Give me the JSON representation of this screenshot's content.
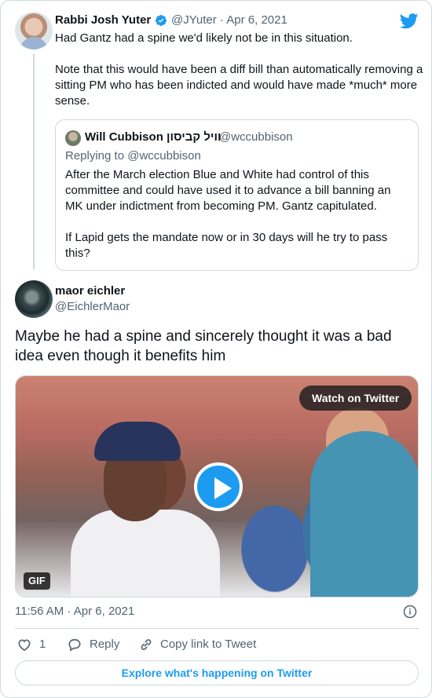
{
  "parent_tweet": {
    "author_name": "Rabbi Josh Yuter",
    "handle": "@JYuter",
    "date": "Apr 6, 2021",
    "text": "Had Gantz had a spine we'd likely not be in this situation.\n\nNote that this would have been a diff bill than automatically removing a sitting PM who has been indicted and would have made *much* more sense."
  },
  "quoted_tweet": {
    "author_name": "Will Cubbison וויל קביסון",
    "handle": "@wccubbison",
    "replying_to": "Replying to @wccubbison",
    "text": "After the March election Blue and White had control of this committee and could have used it to advance a bill banning an MK under indictment from becoming PM. Gantz capitulated.\n\nIf Lapid gets the mandate now or in 30 days will he try to pass this?"
  },
  "tweet": {
    "author_name": "maor eichler",
    "handle": "@EichlerMaor",
    "text": "Maybe he had a spine and sincerely thought it was a bad idea even though it benefits him",
    "media": {
      "watch_label": "Watch on Twitter",
      "badge": "GIF"
    },
    "timestamp": "11:56 AM · Apr 6, 2021"
  },
  "actions": {
    "like_count": "1",
    "reply_label": "Reply",
    "copy_link_label": "Copy link to Tweet"
  },
  "explore_label": "Explore what's happening on Twitter",
  "colors": {
    "accent": "#1d9bf0",
    "secondary_text": "#536471",
    "border": "#cfd9de"
  }
}
